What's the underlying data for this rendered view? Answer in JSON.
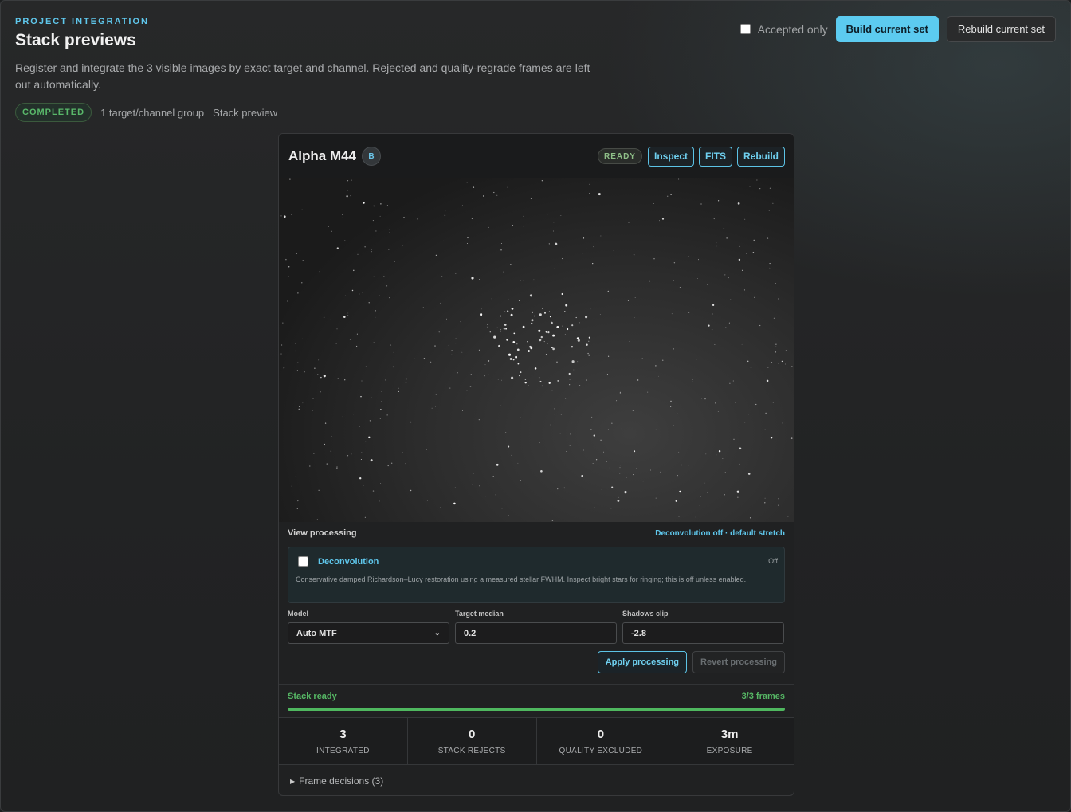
{
  "header": {
    "eyebrow": "PROJECT INTEGRATION",
    "title": "Stack previews",
    "description": "Register and integrate the 3 visible images by exact target and channel. Rejected and quality-regrade frames are left out automatically."
  },
  "status": {
    "badge": "COMPLETED",
    "groups": "1 target/channel group",
    "mode": "Stack preview"
  },
  "top_actions": {
    "accepted_only_label": "Accepted only",
    "accepted_only_checked": false,
    "build_label": "Build current set",
    "rebuild_label": "Rebuild current set"
  },
  "card": {
    "title": "Alpha M44",
    "channel": "B",
    "state": "READY",
    "inspect_label": "Inspect",
    "fits_label": "FITS",
    "rebuild_label": "Rebuild"
  },
  "processing": {
    "title": "View processing",
    "summary": "Deconvolution off · default stretch",
    "deconvolution": {
      "label": "Deconvolution",
      "checked": false,
      "state": "Off",
      "description": "Conservative damped Richardson–Lucy restoration using a measured stellar FWHM. Inspect bright stars for ringing; this is off unless enabled."
    },
    "model_label": "Model",
    "model_value": "Auto MTF",
    "target_median_label": "Target median",
    "target_median_value": "0.2",
    "shadows_clip_label": "Shadows clip",
    "shadows_clip_value": "-2.8",
    "apply_label": "Apply processing",
    "revert_label": "Revert processing"
  },
  "stack": {
    "status": "Stack ready",
    "frames": "3/3 frames",
    "progress": 1.0
  },
  "stats": [
    {
      "value": "3",
      "label": "INTEGRATED"
    },
    {
      "value": "0",
      "label": "STACK REJECTS"
    },
    {
      "value": "0",
      "label": "QUALITY EXCLUDED"
    },
    {
      "value": "3m",
      "label": "EXPOSURE"
    }
  ],
  "frame_decisions_label": "Frame decisions (3)",
  "colors": {
    "accent": "#5ccbf0",
    "success": "#4fb85f"
  }
}
